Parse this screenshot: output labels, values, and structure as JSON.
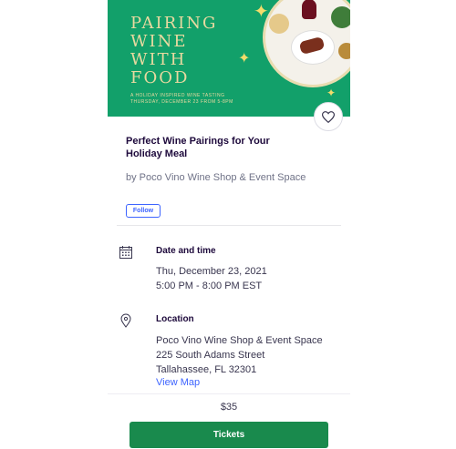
{
  "hero": {
    "title": "Pairing Wine With Food",
    "subtitle_line1": "A Holiday Inspired Wine Tasting",
    "subtitle_line2": "Thursday, December 23 from 5-8PM"
  },
  "event": {
    "title": "Perfect Wine Pairings for Your Holiday Meal",
    "organizer": "by Poco Vino Wine Shop & Event Space",
    "follow_label": "Follow"
  },
  "date_time": {
    "heading": "Date and time",
    "date": "Thu, December 23, 2021",
    "time": "5:00 PM - 8:00 PM EST"
  },
  "location": {
    "heading": "Location",
    "venue": "Poco Vino Wine Shop & Event Space",
    "street": "225 South Adams Street",
    "city": "Tallahassee, FL 32301",
    "map_link": "View Map"
  },
  "footer": {
    "price": "$35",
    "tickets_label": "Tickets"
  },
  "colors": {
    "hero_bg": "#12a06a",
    "hero_text": "#e8d9a0",
    "tickets_bg": "#198a4d",
    "link": "#3d64ff"
  },
  "icons": [
    "heart-icon",
    "calendar-icon",
    "location-pin-icon",
    "sparkle-icon"
  ]
}
